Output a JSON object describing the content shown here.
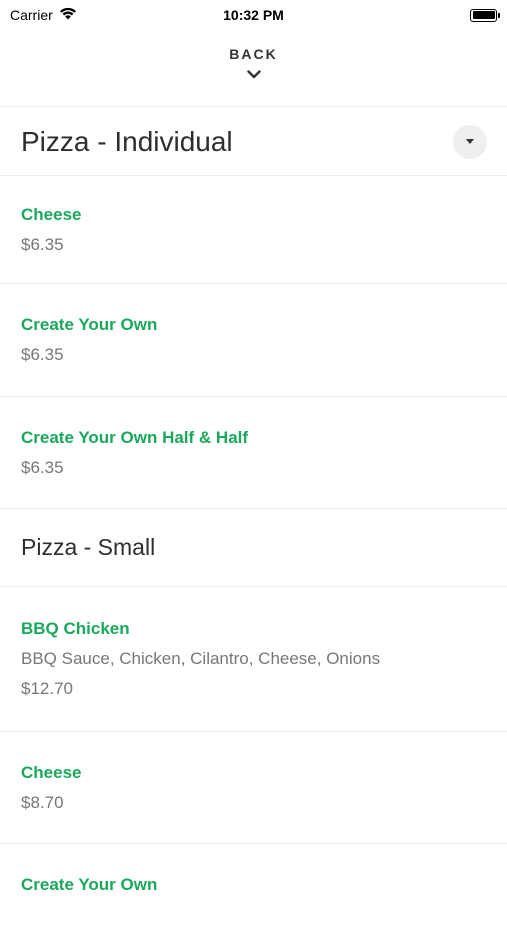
{
  "status_bar": {
    "carrier": "Carrier",
    "time": "10:32 PM"
  },
  "nav": {
    "back_label": "BACK"
  },
  "sections": [
    {
      "title": "Pizza - Individual",
      "items": [
        {
          "name": "Cheese",
          "price": "$6.35"
        },
        {
          "name": "Create Your Own",
          "price": "$6.35"
        },
        {
          "name": "Create Your Own Half & Half",
          "price": "$6.35"
        }
      ]
    },
    {
      "title": "Pizza - Small",
      "items": [
        {
          "name": "BBQ Chicken",
          "description": "BBQ Sauce, Chicken, Cilantro, Cheese, Onions",
          "price": "$12.70"
        },
        {
          "name": "Cheese",
          "price": "$8.70"
        },
        {
          "name": "Create Your Own"
        }
      ]
    }
  ],
  "colors": {
    "accent": "#1aa95c",
    "muted": "#777777",
    "divider": "#ececec"
  }
}
